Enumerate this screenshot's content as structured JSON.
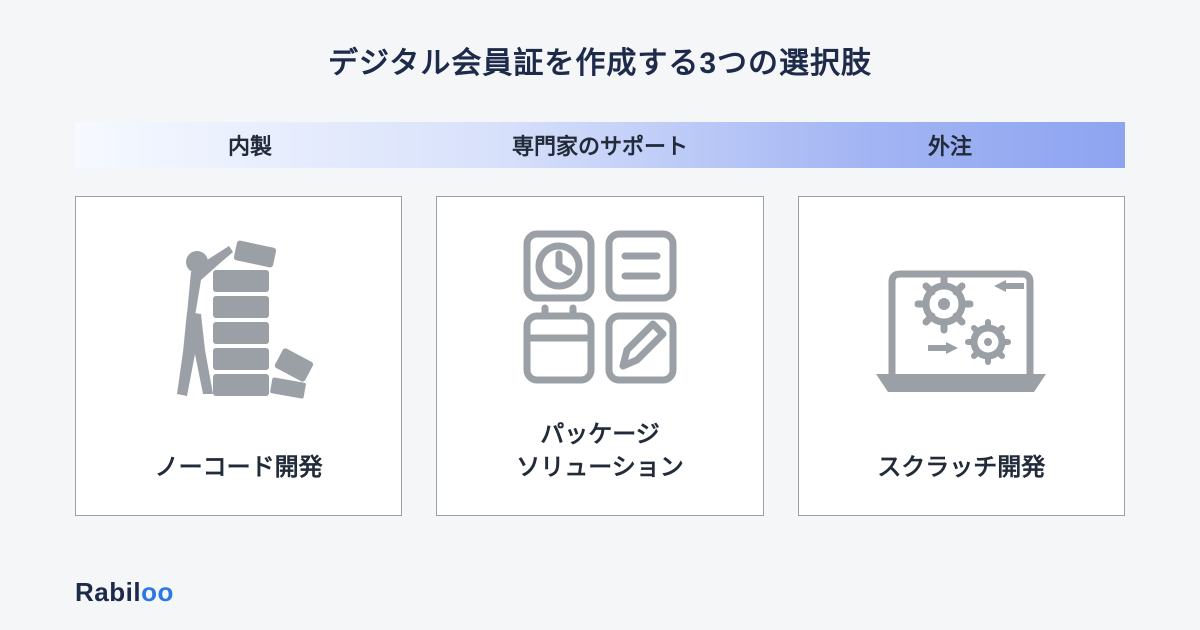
{
  "title": "デジタル会員証を作成する3つの選択肢",
  "spectrum": {
    "left": "内製",
    "center": "専門家のサポート",
    "right": "外注"
  },
  "cards": [
    {
      "icon": "builder-icon",
      "caption": "ノーコード開発"
    },
    {
      "icon": "apps-icon",
      "caption": "パッケージ\nソリューション"
    },
    {
      "icon": "gears-icon",
      "caption": "スクラッチ開発"
    }
  ],
  "logo": {
    "part1": "Rabil",
    "part2": "oo"
  }
}
